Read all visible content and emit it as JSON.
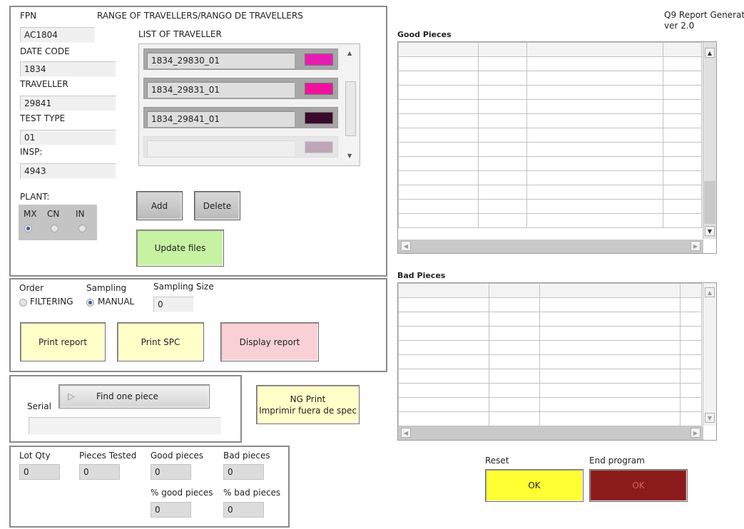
{
  "app": {
    "title": "Q9 Report Generator",
    "version": "ver 2.0"
  },
  "top_panel": {
    "range_title": "RANGE OF TRAVELLERS/RANGO DE TRAVELLERS",
    "fpn_label": "FPN",
    "fpn_value": "AC1804",
    "date_code_label": "DATE CODE",
    "date_code_value": "1834",
    "traveller_label": "TRAVELLER",
    "traveller_value": "29841",
    "test_type_label": "TEST TYPE",
    "test_type_value": "01",
    "insp_label": "INSP:",
    "insp_value": "4943",
    "plant_label": "PLANT:",
    "plants": [
      {
        "label": "MX",
        "selected": true
      },
      {
        "label": "CN",
        "selected": false
      },
      {
        "label": "IN",
        "selected": false
      }
    ],
    "list_label": "LIST OF TRAVELLER",
    "travellers": [
      {
        "name": "1834_29830_01",
        "color": "#e81cb4"
      },
      {
        "name": "1834_29831_01",
        "color": "#f0129e"
      },
      {
        "name": "1834_29841_01",
        "color": "#3a0a2c"
      },
      {
        "name": "",
        "color": "#bfa6b8"
      }
    ],
    "add_label": "Add",
    "delete_label": "Delete",
    "update_label": "Update files"
  },
  "options_panel": {
    "order_label": "Order",
    "sampling_label": "Sampling",
    "filtering_label": "FILTERING",
    "manual_label": "MANUAL",
    "sampling_size_label": "Sampling Size",
    "sampling_size_value": "0",
    "print_report_label": "Print report",
    "print_spc_label": "Print SPC",
    "display_report_label": "Display report"
  },
  "serial_panel": {
    "find_label": "Find one piece",
    "serial_label": "Serial",
    "serial_value": "",
    "ng_print_line1": "NG Print",
    "ng_print_line2": "Imprimir fuera de spec"
  },
  "stats_panel": {
    "lot_qty_label": "Lot Qty",
    "lot_qty_value": "0",
    "pieces_tested_label": "Pieces Tested",
    "pieces_tested_value": "0",
    "good_pieces_label": "Good pieces",
    "good_pieces_value": "0",
    "bad_pieces_label": "Bad pieces",
    "bad_pieces_value": "0",
    "pct_good_label": "% good pieces",
    "pct_good_value": "0",
    "pct_bad_label": "% bad pieces",
    "pct_bad_value": "0"
  },
  "good_table": {
    "title": "Good Pieces"
  },
  "bad_table": {
    "title": "Bad Pieces"
  },
  "controls": {
    "reset_label": "Reset",
    "reset_button": "OK",
    "end_label": "End program",
    "end_button": "OK"
  },
  "colors": {
    "yellow": "#ffff33",
    "dark_red": "#8b1a1a",
    "green_btn": "#c6f2a2",
    "light_yellow": "#ffffc8",
    "pink": "#f9d0d6"
  }
}
